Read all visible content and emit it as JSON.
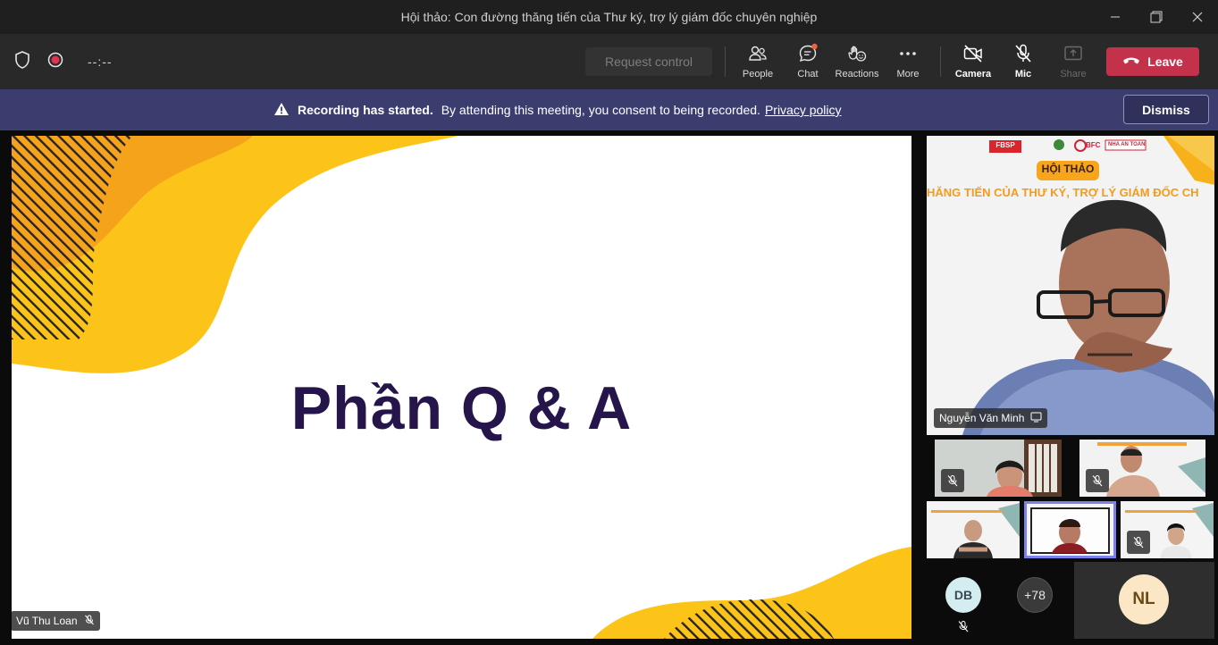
{
  "window": {
    "title": "Hội thảo: Con đường thăng tiến của Thư ký, trợ lý giám đốc chuyên nghiệp"
  },
  "toolbar": {
    "timer": "--:--",
    "request_control": "Request control",
    "people": "People",
    "chat": "Chat",
    "reactions": "Reactions",
    "more": "More",
    "camera": "Camera",
    "mic": "Mic",
    "share": "Share",
    "leave": "Leave"
  },
  "banner": {
    "heading": "Recording has started.",
    "message": "By attending this meeting, you consent to being recorded.",
    "link": "Privacy policy",
    "dismiss": "Dismiss"
  },
  "stage": {
    "slide_title": "Phần Q & A",
    "presenter_name": "Vũ Thu Loan"
  },
  "featured": {
    "name": "Nguyễn Văn Minh",
    "banner_label": "HỘI THẢO",
    "banner_text": "HĂNG TIẾN CỦA THƯ KÝ, TRỢ LÝ GIÁM ĐỐC CH",
    "logos": [
      "FBSP",
      "BFC",
      "NHA AN TOAN"
    ]
  },
  "roster": {
    "avatar_db": "DB",
    "more_count": "+78",
    "avatar_nl": "NL"
  },
  "colors": {
    "accent": "#c4314b",
    "banner": "#3b3d6e",
    "slide_title": "#26154a",
    "slide_yellow": "#fcc419",
    "slide_orange": "#f5a31a"
  }
}
